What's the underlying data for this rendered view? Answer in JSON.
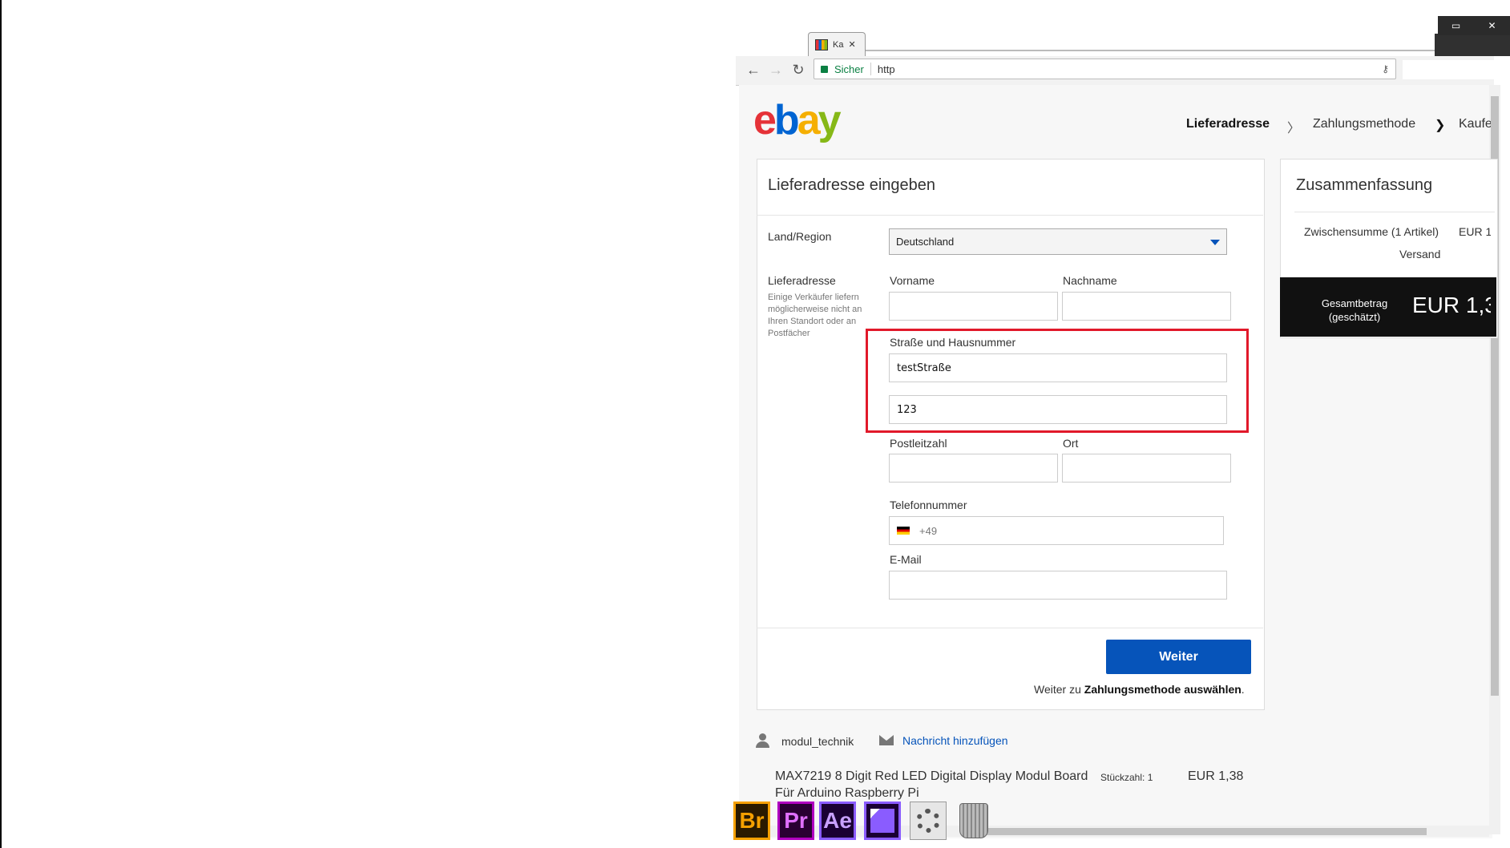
{
  "browser": {
    "tab_title": "Ka",
    "tab_close": "✕",
    "secure_label": "Sicher",
    "url": "http",
    "window_buttons": [
      "▭",
      "✕"
    ]
  },
  "header": {
    "logo": {
      "e": "e",
      "b": "b",
      "a": "a",
      "y": "y"
    },
    "steps": [
      "Lieferadresse",
      "Zahlungsmethode",
      "Kaufe"
    ],
    "step_separator": "❯"
  },
  "form": {
    "title": "Lieferadresse eingeben",
    "country_label": "Land/Region",
    "country_value": "Deutschland",
    "address_label": "Lieferadresse",
    "address_hint": "Einige Verkäufer liefern möglicherweise nicht an Ihren Standort oder an Postfächer",
    "firstname_label": "Vorname",
    "firstname_value": "",
    "lastname_label": "Nachname",
    "lastname_value": "",
    "street_label": "Straße und Hausnummer",
    "street_value": "testStraße",
    "street2_value": "123",
    "zip_label": "Postleitzahl",
    "zip_value": "",
    "city_label": "Ort",
    "city_value": "",
    "phone_label": "Telefonnummer",
    "phone_prefix": "+49",
    "email_label": "E-Mail",
    "email_value": "",
    "continue_button": "Weiter",
    "continue_note_prefix": "Weiter zu ",
    "continue_note_bold": "Zahlungsmethode auswählen",
    "continue_note_suffix": "."
  },
  "summary": {
    "title": "Zusammenfassung",
    "subtotal_label": "Zwischensumme (1 Artikel)",
    "subtotal_value": "EUR 1",
    "shipping_label": "Versand",
    "total_label": "Gesamtbetrag (geschätzt)",
    "total_value": "EUR 1,3"
  },
  "seller": {
    "name": "modul_technik",
    "message_link": "Nachricht hinzufügen"
  },
  "item": {
    "title": "MAX7219 8 Digit Red LED Digital Display Modul Board Für Arduino Raspberry Pi",
    "quantity": "Stückzahl: 1",
    "price": "EUR 1,38"
  },
  "dock": {
    "bridge": "Br",
    "premiere": "Pr",
    "after_effects": "Ae"
  },
  "colors": {
    "highlight": "#e1192a",
    "primary_button": "#0654ba",
    "ebay_red": "#e53238",
    "ebay_blue": "#0064d2",
    "ebay_yellow": "#f5af02",
    "ebay_green": "#86b817"
  }
}
